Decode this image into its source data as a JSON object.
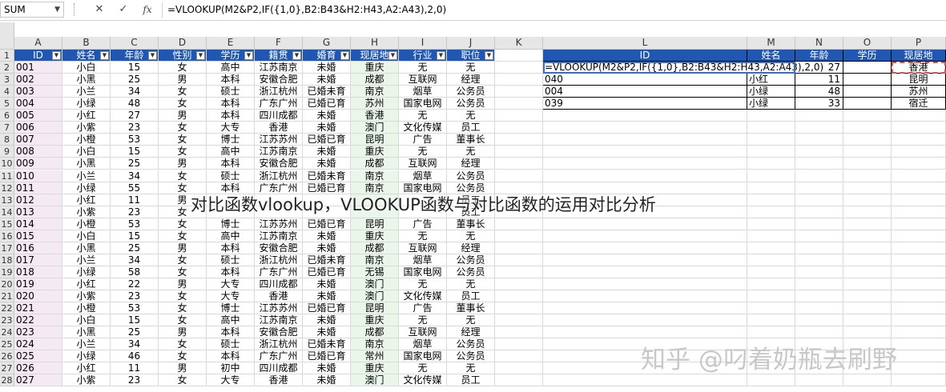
{
  "formula_bar": {
    "name_box": "SUM",
    "cancel_icon": "✕",
    "enter_icon": "✓",
    "fx_label": "fx",
    "formula": "=VLOOKUP(M2&P2,IF({1,0},B2:B43&H2:H43,A2:A43),2,0)"
  },
  "columns": [
    "A",
    "B",
    "C",
    "D",
    "E",
    "F",
    "G",
    "H",
    "I",
    "J",
    "K",
    "L",
    "M",
    "N",
    "O",
    "P"
  ],
  "table1": {
    "headers": [
      "ID",
      "姓名",
      "年龄",
      "性别",
      "学历",
      "籍贯",
      "婚育",
      "现居地",
      "行业",
      "职位"
    ],
    "rows": [
      [
        "001",
        "小白",
        "15",
        "女",
        "高中",
        "江苏南京",
        "未婚",
        "重庆",
        "无",
        "无"
      ],
      [
        "002",
        "小黑",
        "25",
        "男",
        "本科",
        "安徽合肥",
        "未婚",
        "成都",
        "互联网",
        "经理"
      ],
      [
        "003",
        "小兰",
        "34",
        "女",
        "硕士",
        "浙江杭州",
        "已婚未育",
        "南京",
        "烟草",
        "公务员"
      ],
      [
        "004",
        "小绿",
        "48",
        "女",
        "本科",
        "广东广州",
        "已婚已育",
        "苏州",
        "国家电网",
        "公务员"
      ],
      [
        "005",
        "小红",
        "27",
        "男",
        "本科",
        "四川成都",
        "未婚",
        "香港",
        "无",
        "无"
      ],
      [
        "006",
        "小紫",
        "23",
        "女",
        "大专",
        "香港",
        "未婚",
        "澳门",
        "文化传媒",
        "员工"
      ],
      [
        "007",
        "小橙",
        "53",
        "女",
        "博士",
        "江苏苏州",
        "已婚已育",
        "昆明",
        "广告",
        "董事长"
      ],
      [
        "008",
        "小白",
        "15",
        "女",
        "高中",
        "江苏南京",
        "未婚",
        "重庆",
        "无",
        "无"
      ],
      [
        "009",
        "小黑",
        "25",
        "男",
        "本科",
        "安徽合肥",
        "未婚",
        "成都",
        "互联网",
        "经理"
      ],
      [
        "010",
        "小兰",
        "34",
        "女",
        "硕士",
        "浙江杭州",
        "已婚未育",
        "南京",
        "烟草",
        "公务员"
      ],
      [
        "011",
        "小绿",
        "55",
        "女",
        "本科",
        "广东广州",
        "已婚已育",
        "南京",
        "国家电网",
        "公务员"
      ],
      [
        "012",
        "小红",
        "11",
        "男",
        "",
        "",
        "",
        "",
        "",
        "员工"
      ],
      [
        "013",
        "小紫",
        "23",
        "女",
        "",
        "",
        "",
        "",
        "",
        "员工"
      ],
      [
        "014",
        "小橙",
        "53",
        "女",
        "博士",
        "江苏苏州",
        "已婚已育",
        "昆明",
        "广告",
        "董事长"
      ],
      [
        "015",
        "小白",
        "15",
        "女",
        "高中",
        "江苏南京",
        "未婚",
        "重庆",
        "无",
        "无"
      ],
      [
        "016",
        "小黑",
        "25",
        "男",
        "本科",
        "安徽合肥",
        "未婚",
        "成都",
        "互联网",
        "经理"
      ],
      [
        "017",
        "小兰",
        "34",
        "女",
        "硕士",
        "浙江杭州",
        "已婚未育",
        "南京",
        "烟草",
        "公务员"
      ],
      [
        "018",
        "小绿",
        "58",
        "女",
        "本科",
        "广东广州",
        "已婚已育",
        "无锡",
        "国家电网",
        "公务员"
      ],
      [
        "019",
        "小红",
        "22",
        "男",
        "大专",
        "四川成都",
        "未婚",
        "澳门",
        "无",
        "无"
      ],
      [
        "020",
        "小紫",
        "23",
        "女",
        "大专",
        "香港",
        "未婚",
        "澳门",
        "文化传媒",
        "员工"
      ],
      [
        "021",
        "小橙",
        "53",
        "女",
        "博士",
        "江苏苏州",
        "已婚已育",
        "昆明",
        "广告",
        "董事长"
      ],
      [
        "022",
        "小白",
        "15",
        "女",
        "高中",
        "江苏南京",
        "未婚",
        "重庆",
        "无",
        "无"
      ],
      [
        "023",
        "小黑",
        "25",
        "男",
        "本科",
        "安徽合肥",
        "未婚",
        "成都",
        "互联网",
        "经理"
      ],
      [
        "024",
        "小兰",
        "34",
        "女",
        "硕士",
        "浙江杭州",
        "已婚未育",
        "南京",
        "烟草",
        "公务员"
      ],
      [
        "025",
        "小绿",
        "46",
        "女",
        "本科",
        "广东广州",
        "已婚已育",
        "常州",
        "国家电网",
        "公务员"
      ],
      [
        "026",
        "小红",
        "11",
        "男",
        "初中",
        "四川成都",
        "未婚",
        "重庆",
        "无",
        "无"
      ],
      [
        "027",
        "小紫",
        "23",
        "女",
        "大专",
        "香港",
        "未婚",
        "澳门",
        "文化传媒",
        "员工"
      ]
    ]
  },
  "table2": {
    "headers": [
      "ID",
      "姓名",
      "年龄",
      "学历",
      "现居地"
    ],
    "rows": [
      [
        "=VLOOKUP(M2&P2,IF({1,0},B2:B43&H2:H43,A2:A43),2,0)",
        "",
        "27",
        "",
        "香港"
      ],
      [
        "040",
        "小红",
        "11",
        "",
        "昆明"
      ],
      [
        "004",
        "小绿",
        "48",
        "",
        "苏州"
      ],
      [
        "039",
        "小绿",
        "33",
        "",
        "宿迁"
      ]
    ]
  },
  "overlay_title": "对比函数vlookup，VLOOKUP函数与对比函数的运用对比分析",
  "watermark": "知乎 @叼着奶瓶去刷野",
  "colors": {
    "header_blue": "#1f57b3",
    "colA_tint": "#f5e9f3",
    "colH_tint": "#eaf6ea"
  }
}
